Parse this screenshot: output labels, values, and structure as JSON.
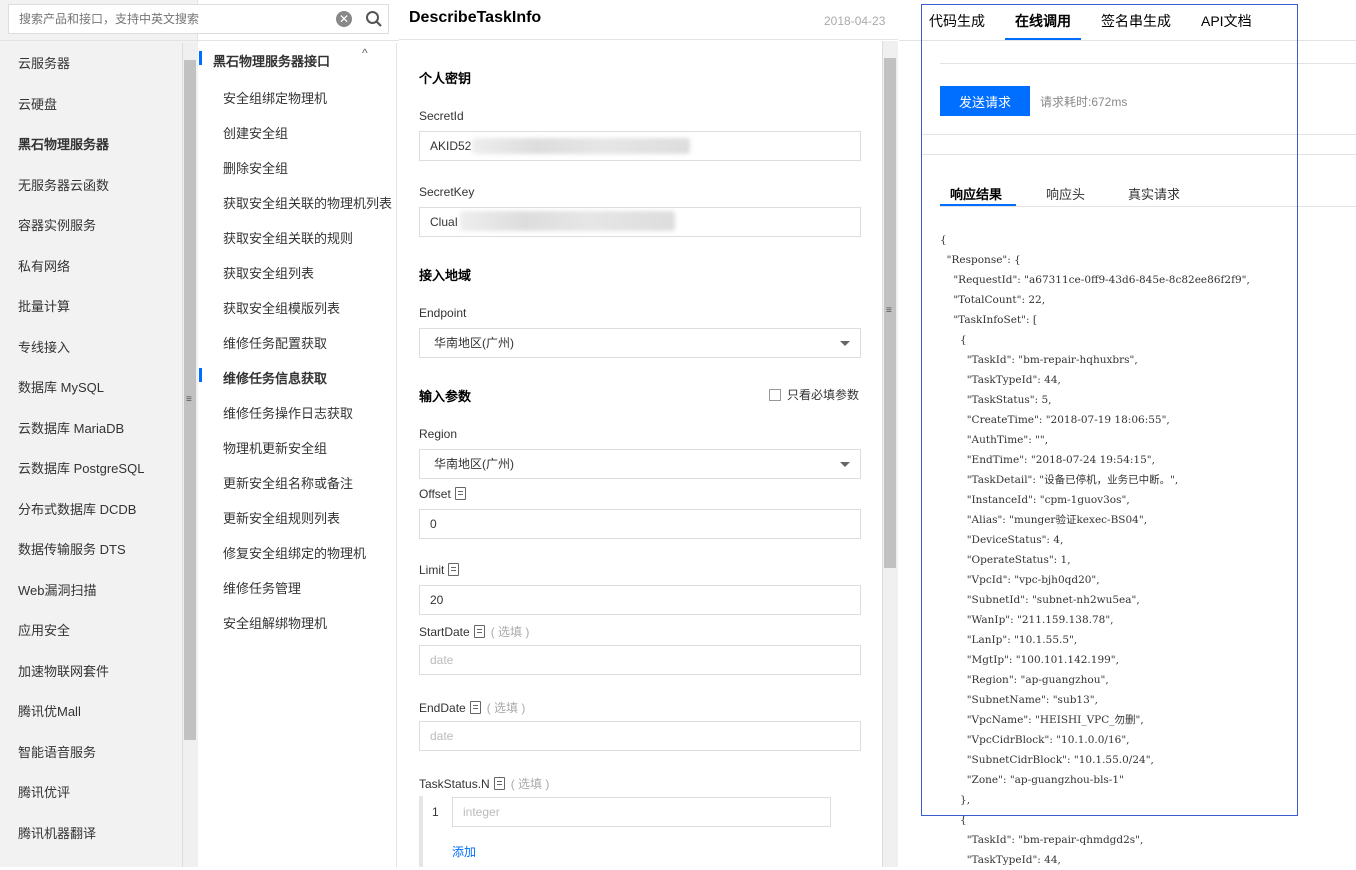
{
  "search": {
    "placeholder": "搜索产品和接口，支持中英文搜索"
  },
  "products": [
    "云服务器",
    "云硬盘",
    "黑石物理服务器",
    "无服务器云函数",
    "容器实例服务",
    "私有网络",
    "批量计算",
    "专线接入",
    "数据库 MySQL",
    "云数据库 MariaDB",
    "云数据库 PostgreSQL",
    "分布式数据库 DCDB",
    "数据传输服务 DTS",
    "Web漏洞扫描",
    "应用安全",
    "加速物联网套件",
    "腾讯优Mall",
    "智能语音服务",
    "腾讯优评",
    "腾讯机器翻译"
  ],
  "api_group": {
    "title": "黑石物理服务器接口",
    "toggle": "^"
  },
  "apis": [
    "安全组绑定物理机",
    "创建安全组",
    "删除安全组",
    "获取安全组关联的物理机列表",
    "获取安全组关联的规则",
    "获取安全组列表",
    "获取安全组模版列表",
    "维修任务配置获取",
    "维修任务信息获取",
    "维修任务操作日志获取",
    "物理机更新安全组",
    "更新安全组名称或备注",
    "更新安全组规则列表",
    "修复安全组绑定的物理机",
    "维修任务管理",
    "安全组解绑物理机"
  ],
  "header": {
    "title": "DescribeTaskInfo",
    "date": "2018-04-23"
  },
  "form": {
    "key_section": "个人密钥",
    "secret_id_label": "SecretId",
    "secret_id_value": "AKID52",
    "secret_key_label": "SecretKey",
    "secret_key_value": "CluaI",
    "region_section": "接入地域",
    "endpoint_label": "Endpoint",
    "endpoint_value": "华南地区(广州)",
    "input_section": "输入参数",
    "required_only": "只看必填参数",
    "region_label": "Region",
    "region_value": "华南地区(广州)",
    "offset_label": "Offset",
    "offset_value": "0",
    "limit_label": "Limit",
    "limit_value": "20",
    "startdate_label": "StartDate",
    "enddate_label": "EndDate",
    "optional": "( 选填 )",
    "date_placeholder": "date",
    "taskstatus_label": "TaskStatus.N",
    "taskstatus_index": "1",
    "integer_placeholder": "integer",
    "add_label": "添加"
  },
  "call": {
    "tabs": [
      "代码生成",
      "在线调用",
      "签名串生成",
      "API文档"
    ],
    "active_tab": "在线调用",
    "send_label": "发送请求",
    "elapsed": "请求耗时:672ms",
    "subtabs": [
      "响应结果",
      "响应头",
      "真实请求"
    ],
    "response_lines": [
      "{",
      "  \"Response\": {",
      "    \"RequestId\": \"a67311ce-0ff9-43d6-845e-8c82ee86f2f9\",",
      "    \"TotalCount\": 22,",
      "    \"TaskInfoSet\": [",
      "      {",
      "        \"TaskId\": \"bm-repair-hqhuxbrs\",",
      "        \"TaskTypeId\": 44,",
      "        \"TaskStatus\": 5,",
      "        \"CreateTime\": \"2018-07-19 18:06:55\",",
      "        \"AuthTime\": \"\",",
      "        \"EndTime\": \"2018-07-24 19:54:15\",",
      "        \"TaskDetail\": \"设备已停机，业务已中断。\",",
      "        \"InstanceId\": \"cpm-1guov3os\",",
      "        \"Alias\": \"munger验证kexec-BS04\",",
      "        \"DeviceStatus\": 4,",
      "        \"OperateStatus\": 1,",
      "        \"VpcId\": \"vpc-bjh0qd20\",",
      "        \"SubnetId\": \"subnet-nh2wu5ea\",",
      "        \"WanIp\": \"211.159.138.78\",",
      "        \"LanIp\": \"10.1.55.5\",",
      "        \"MgtIp\": \"100.101.142.199\",",
      "        \"Region\": \"ap-guangzhou\",",
      "        \"SubnetName\": \"sub13\",",
      "        \"VpcName\": \"HEISHI_VPC_勿删\",",
      "        \"VpcCidrBlock\": \"10.1.0.0/16\",",
      "        \"SubnetCidrBlock\": \"10.1.55.0/24\",",
      "        \"Zone\": \"ap-guangzhou-bls-1\"",
      "      },",
      "      {",
      "        \"TaskId\": \"bm-repair-qhmdgd2s\",",
      "        \"TaskTypeId\": 44,"
    ]
  }
}
